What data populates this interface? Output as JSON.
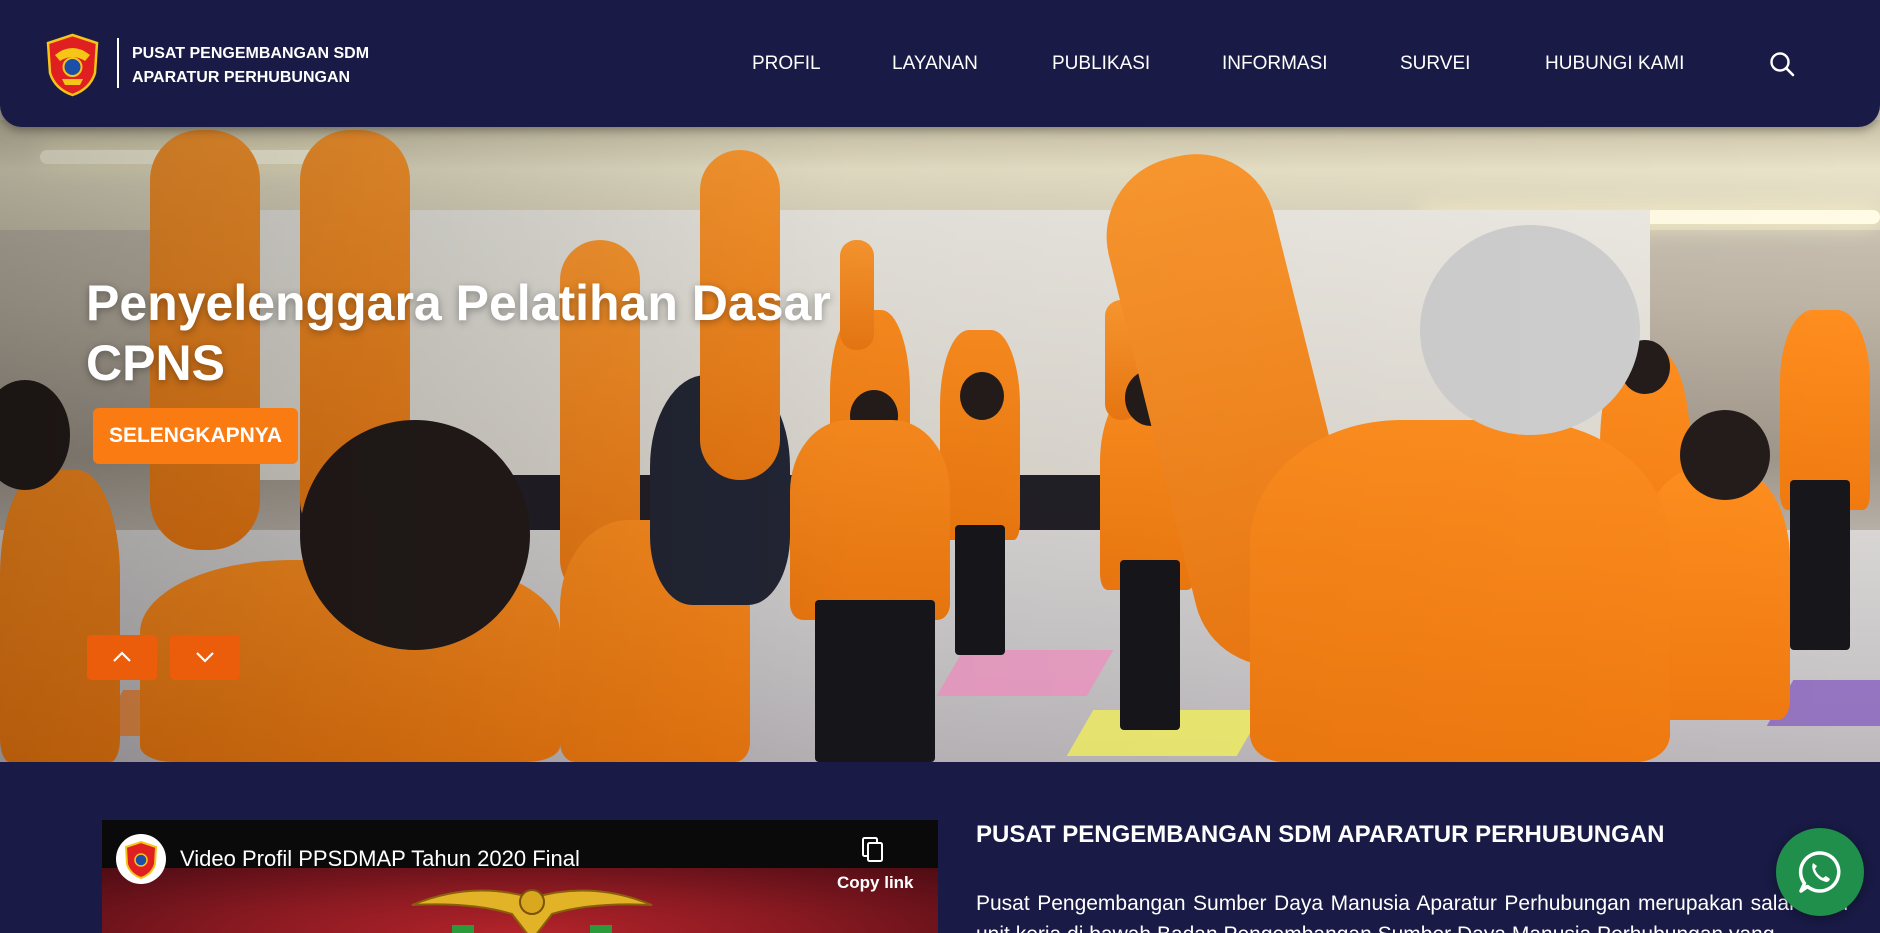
{
  "brand": {
    "line1": "PUSAT PENGEMBANGAN SDM",
    "line2": "APARATUR PERHUBUNGAN"
  },
  "nav": {
    "items": [
      "PROFIL",
      "LAYANAN",
      "PUBLIKASI",
      "INFORMASI",
      "SURVEI",
      "HUBUNGI KAMI"
    ]
  },
  "hero": {
    "title_line1": "Penyelenggara Pelatihan Dasar",
    "title_line2": "CPNS",
    "button_label": "SELENGKAPNYA"
  },
  "video": {
    "title": "Video Profil PPSDMAP Tahun 2020 Final",
    "copy_label": "Copy link"
  },
  "about": {
    "title": "PUSAT PENGEMBANGAN SDM APARATUR PERHUBUNGAN",
    "text": "Pusat Pengembangan Sumber Daya Manusia Aparatur Perhubungan merupakan salah satu unit kerja di bawah Badan Pengembangan Sumber Daya Manusia Perhubungan yang"
  },
  "icons": {
    "search": "search-icon",
    "up": "chevron-up-icon",
    "down": "chevron-down-icon",
    "whatsapp": "whatsapp-icon",
    "copy": "copy-icon"
  },
  "colors": {
    "navy": "#191a45",
    "accent_orange": "#fa7b12",
    "arrow_orange": "#eb5c0b",
    "whatsapp_green": "#1f8f4b"
  }
}
